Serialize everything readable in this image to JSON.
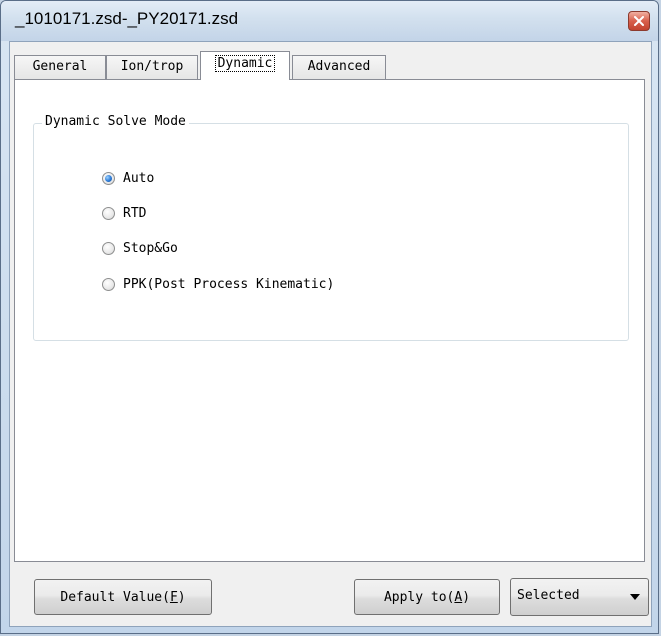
{
  "window": {
    "title": "_1010171.zsd-_PY20171.zsd"
  },
  "tabs": [
    {
      "label": "General",
      "active": false
    },
    {
      "label": "Ion/trop",
      "active": false
    },
    {
      "label": "Dynamic",
      "active": true
    },
    {
      "label": "Advanced",
      "active": false
    }
  ],
  "dynamic_panel": {
    "group_title": "Dynamic Solve Mode",
    "options": [
      {
        "label": "Auto",
        "checked": true
      },
      {
        "label": "RTD",
        "checked": false
      },
      {
        "label": "Stop&Go",
        "checked": false
      },
      {
        "label": "PPK(Post Process Kinematic)",
        "checked": false
      }
    ]
  },
  "footer": {
    "default_button": {
      "text": "Default Value(",
      "accel": "F",
      "close": ")"
    },
    "apply_button": {
      "text": "Apply to(",
      "accel": "A",
      "close": ")"
    },
    "select": {
      "value": "Selected"
    }
  },
  "icons": {
    "close": "close-icon",
    "dropdown": "chevron-down-icon"
  },
  "colors": {
    "title_bar": "#d2e0ee",
    "close_button": "#d8604c",
    "radio_selected": "#2b7ad6",
    "panel_background": "#ffffff",
    "dialog_background": "#f0f0f0"
  }
}
